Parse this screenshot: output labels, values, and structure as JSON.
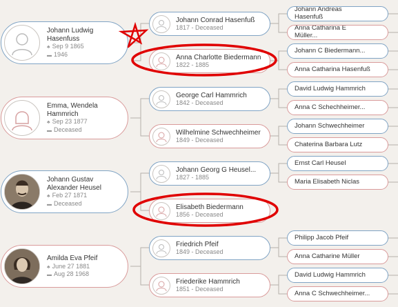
{
  "colors": {
    "male": "#7fa3c4",
    "female": "#d99a9a",
    "annotation": "#e00000"
  },
  "people": {
    "p1": {
      "name": "Johann Ludwig Hasenfuss",
      "birth": "Sep 9 1865",
      "death": "1946",
      "gender": "male",
      "photo": "silhouette-male"
    },
    "p1f": {
      "name": "Johann Conrad Hasenfuß",
      "dates": "1817 - Deceased",
      "gender": "male"
    },
    "p1m": {
      "name": "Anna Charlotte Biedermann",
      "dates": "1822 - 1885",
      "gender": "female"
    },
    "p1ff": {
      "name": "Johann Andreas Hasenfuß",
      "gender": "male"
    },
    "p1fm": {
      "name": "Anna Catharina E Müller...",
      "gender": "female"
    },
    "p1mf": {
      "name": "Johann C Biedermann...",
      "gender": "male"
    },
    "p1mm": {
      "name": "Anna Catharina Hasenfuß",
      "gender": "female"
    },
    "p2": {
      "name": "Emma, Wendela Hammrich",
      "birth": "Sep 23 1877",
      "death": "Deceased",
      "gender": "female",
      "photo": "silhouette-female"
    },
    "p2f": {
      "name": "George Carl Hammrich",
      "dates": "1842 - Deceased",
      "gender": "male"
    },
    "p2m": {
      "name": "Wilhelmine Schwechheimer",
      "dates": "1849 - Deceased",
      "gender": "female"
    },
    "p2ff": {
      "name": "David Ludwig Hammrich",
      "gender": "male"
    },
    "p2fm": {
      "name": "Anna C Schechheimer...",
      "gender": "female"
    },
    "p2mf": {
      "name": "Johann Schwechheimer",
      "gender": "male"
    },
    "p2mm": {
      "name": "Chaterina Barbara Lutz",
      "gender": "female"
    },
    "p3": {
      "name": "Johann Gustav Alexander Heusel",
      "birth": "Feb 27 1871",
      "death": "Deceased",
      "gender": "male",
      "photo": "portrait-photo"
    },
    "p3f": {
      "name": "Johann Georg G Heusel...",
      "dates": "1827 - 1885",
      "gender": "male"
    },
    "p3m": {
      "name": "Elisabeth Biedermann",
      "dates": "1856 - Deceased",
      "gender": "female"
    },
    "p3ff": {
      "name": "Ernst Carl Heusel",
      "gender": "male"
    },
    "p3fm": {
      "name": "Maria Elisabeth Niclas",
      "gender": "female"
    },
    "p4": {
      "name": "Amilda Eva Pfeif",
      "birth": "June 27 1881",
      "death": "Aug 28 1968",
      "gender": "female",
      "photo": "portrait-photo"
    },
    "p4f": {
      "name": "Friedrich Pfeif",
      "dates": "1849 - Deceased",
      "gender": "male"
    },
    "p4m": {
      "name": "Friederike Hammrich",
      "dates": "1851 - Deceased",
      "gender": "female"
    },
    "p4ff": {
      "name": "Philipp Jacob Pfeif",
      "gender": "male"
    },
    "p4fm": {
      "name": "Anna Catharine Müller",
      "gender": "female"
    },
    "p4mf": {
      "name": "David Ludwig Hammrich",
      "gender": "male"
    },
    "p4mm": {
      "name": "Anna C Schwechheimer...",
      "gender": "female"
    }
  },
  "icons": {
    "birth": "tree-icon",
    "death": "grave-icon"
  }
}
